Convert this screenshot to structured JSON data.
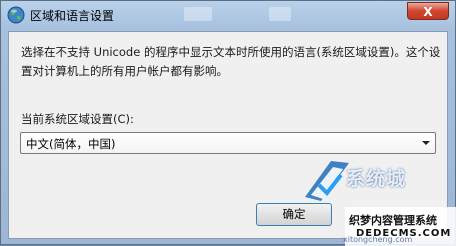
{
  "window": {
    "title": "区域和语言设置",
    "close_label": "X",
    "icon": "globe-icon"
  },
  "dialog": {
    "description": "选择在不支持 Unicode 的程序中显示文本时所使用的语言(系统区域设置)。这个设置对计算机上的所有用户帐户都有影响。",
    "field_label": "当前系统区域设置(C):",
    "select_value": "中文(简体，中国)",
    "ok_label": "确定"
  },
  "watermark": {
    "site_text": "系统城",
    "site_domain": "xitongcheng.com",
    "cms_text": "织梦内容管理系统",
    "cms_domain": "DEDECMS.COM"
  },
  "colors": {
    "close_button": "#d0462f",
    "title_bar": "#b9d1ea",
    "client_bg": "#f0f0f0",
    "ok_border": "#3c7fb1"
  }
}
